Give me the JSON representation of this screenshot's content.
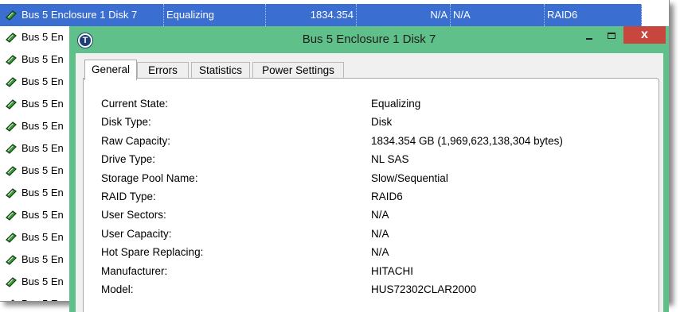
{
  "background_list": {
    "selected_row": {
      "name": "Bus 5 Enclosure 1 Disk 7",
      "state": "Equalizing",
      "capacity": "1834.354",
      "col4": "N/A",
      "col5": "N/A",
      "raid_type": "RAID6"
    },
    "rows": [
      "Bus 5 En",
      "Bus 5 En",
      "Bus 5 En",
      "Bus 5 En",
      "Bus 5 En",
      "Bus 5 En",
      "Bus 5 En",
      "Bus 5 En",
      "Bus 5 En",
      "Bus 5 En",
      "Bus 5 En",
      "Bus 5 En",
      "Bus 5 En"
    ]
  },
  "dialog": {
    "title": "Bus 5 Enclosure 1 Disk 7",
    "app_icon_letter": "T",
    "close_glyph": "x",
    "tabs": [
      "General",
      "Errors",
      "Statistics",
      "Power Settings"
    ],
    "active_tab": "General",
    "properties": [
      {
        "label": "Current State:",
        "value": "Equalizing"
      },
      {
        "label": "Disk Type:",
        "value": "Disk"
      },
      {
        "label": "Raw Capacity:",
        "value": "1834.354 GB   (1,969,623,138,304 bytes)"
      },
      {
        "label": "Drive Type:",
        "value": "NL SAS"
      },
      {
        "label": "Storage Pool Name:",
        "value": "Slow/Sequential"
      },
      {
        "label": "RAID Type:",
        "value": "RAID6"
      },
      {
        "label": "User Sectors:",
        "value": "N/A"
      },
      {
        "label": "User Capacity:",
        "value": "N/A"
      },
      {
        "label": "Hot Spare Replacing:",
        "value": "N/A"
      },
      {
        "label": "Manufacturer:",
        "value": "HITACHI"
      },
      {
        "label": "Model:",
        "value": "HUS72302CLAR2000"
      }
    ]
  },
  "colors": {
    "selection_blue": "#3b6ed1",
    "dialog_frame": "#5fc08a",
    "close_button": "#c7463e",
    "disk_icon_green": "#3a9a3a"
  },
  "icons": {
    "disk": "disk-drive-icon",
    "app": "app-logo-icon",
    "minimize": "minimize-icon",
    "maximize": "maximize-icon",
    "close": "close-icon"
  }
}
